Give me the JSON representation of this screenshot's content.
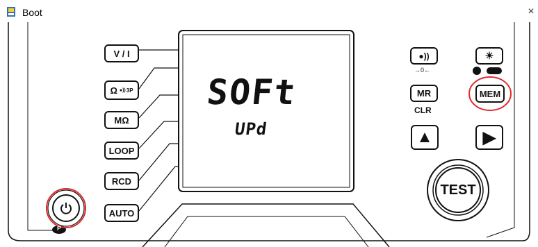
{
  "window": {
    "title": "Boot",
    "close_symbol": "×"
  },
  "display": {
    "main_text": "SOFt",
    "sub_text": "UPd"
  },
  "left_buttons": [
    {
      "id": "vi",
      "label": "V / I"
    },
    {
      "id": "ohm3p",
      "label": "Ω",
      "sub": "3P"
    },
    {
      "id": "mohm",
      "label": "MΩ"
    },
    {
      "id": "loop",
      "label": "LOOP"
    },
    {
      "id": "rcd",
      "label": "RCD"
    },
    {
      "id": "auto",
      "label": "AUTO"
    }
  ],
  "right_buttons": {
    "beeper_caption": "→0←",
    "mr_label": "MR",
    "clr_label": "CLR",
    "mem_label": "MEM",
    "test_label": "TEST"
  },
  "power": {
    "badge": "P"
  },
  "colors": {
    "highlight": "#e0292c",
    "ink": "#111111"
  }
}
